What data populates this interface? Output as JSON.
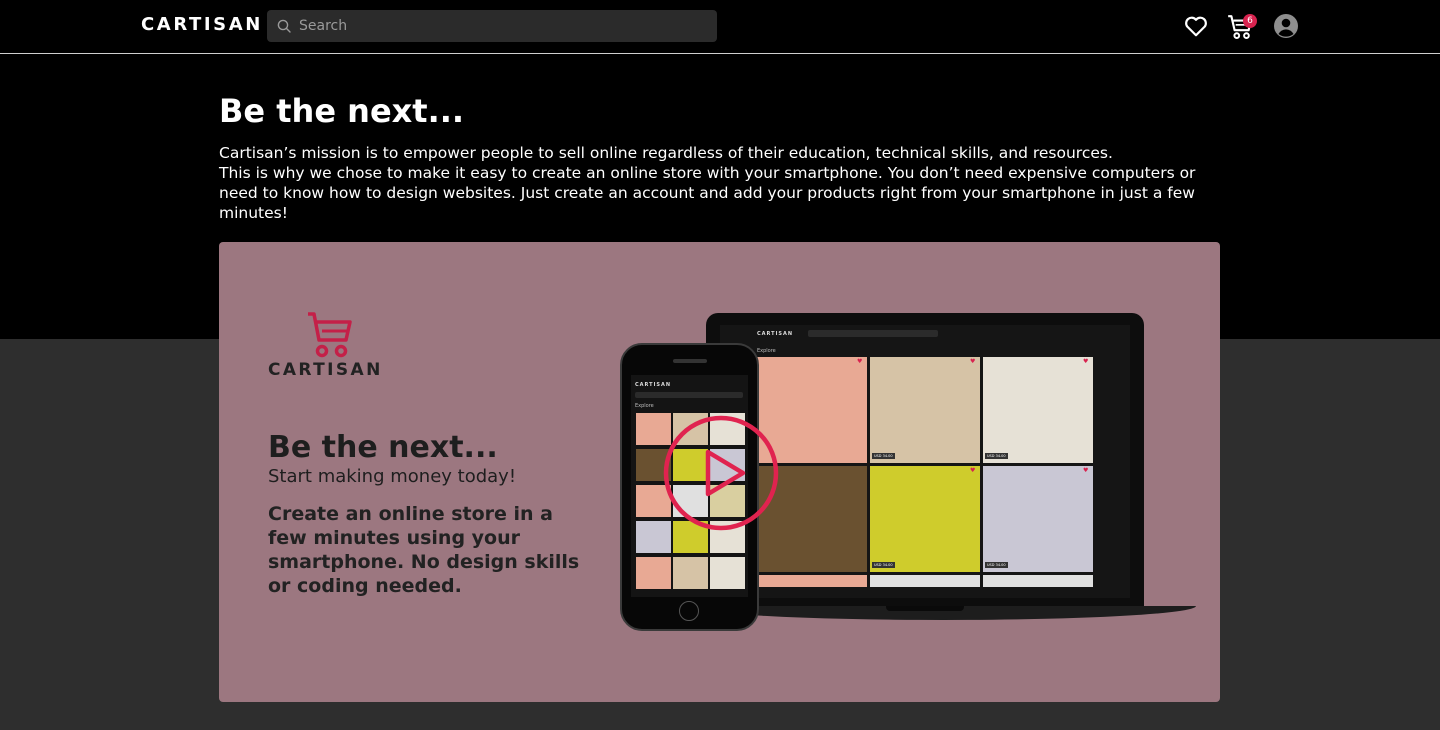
{
  "header": {
    "logo": "CARTISAN",
    "search_placeholder": "Search",
    "cart_count": "6",
    "icons": [
      "heart-icon",
      "cart-icon",
      "account-icon"
    ]
  },
  "hero": {
    "title": "Be the next...",
    "paragraph1": "Cartisan’s mission is to empower people to sell online regardless of their education, technical skills, and resources.",
    "paragraph2": "This is why we chose to make it easy to create an online store with your smartphone. You don’t need expensive computers or need to know how to design websites. Just create an account and add your products right from your smartphone in just a few minutes!"
  },
  "video": {
    "logo_text": "CARTISAN",
    "title": "Be the next...",
    "subtitle": "Start making money today!",
    "description": "Create an online store in a few minutes using your smartphone. No design skills or coding needed.",
    "mockup": {
      "logo": "CARTISAN",
      "search": "Search",
      "section": "Explore",
      "price": "USD 34.00"
    },
    "play_icon": "play-icon"
  },
  "colors": {
    "accent": "#d8234f",
    "card_background": "#9c7780",
    "header_background": "#000000",
    "page_background": "#2e2e2e"
  }
}
